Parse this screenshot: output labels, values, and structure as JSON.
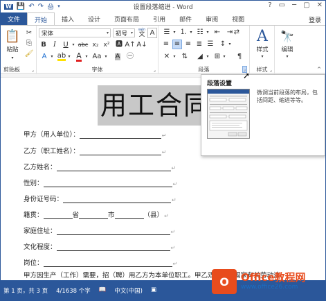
{
  "window": {
    "title": "设置段落缩进 - Word",
    "login": "登录",
    "controls": [
      "?",
      "▭",
      "─",
      "▢",
      "✕"
    ]
  },
  "qat": [
    "Word-icon",
    "save-icon",
    "undo-icon",
    "redo-icon",
    "customize-icon"
  ],
  "tabs": [
    "文件",
    "开始",
    "插入",
    "设计",
    "页面布局",
    "引用",
    "邮件",
    "审阅",
    "视图"
  ],
  "active_tab": "开始",
  "ribbon": {
    "clipboard": {
      "label": "剪贴板",
      "paste": "粘贴"
    },
    "font": {
      "label": "字体",
      "name": "宋体",
      "size": "初号",
      "wen": "wén",
      "A": "A"
    },
    "paragraph": {
      "label": "段落"
    },
    "styles": {
      "label": "样式",
      "button": "样式"
    },
    "editing": {
      "button": "编辑"
    }
  },
  "tooltip": {
    "title": "段落设置",
    "description": "微调当前段落的布局，包括间距、缩进等等。"
  },
  "document": {
    "title": "用工合同",
    "lines": [
      {
        "label": "甲方（用人单位）：",
        "underline": 118
      },
      {
        "label": "乙方（职工姓名）：",
        "underline": 118
      },
      {
        "label": "乙方姓名：",
        "underline": 165
      },
      {
        "label": "性别：",
        "underline": 186
      },
      {
        "label": "身份证号码：",
        "underline": 156
      },
      {
        "label": "籍贯：",
        "underline": 0
      },
      {
        "label": "家庭住址：",
        "underline": 164
      },
      {
        "label": "文化程度：",
        "underline": 164
      },
      {
        "label": "岗位：",
        "underline": 186
      }
    ],
    "jiguan": {
      "seg1": "省",
      "seg2": "市",
      "seg3": "（县）"
    },
    "last_line": "甲方因生产（工作）需要，招（聘）用乙方为本单位职工。甲乙双方根据国家有关劳动法"
  },
  "status": {
    "page": "第 1 页，共 3 页",
    "words": "4/1638 个字",
    "lang": "中文(中国)"
  },
  "watermark": {
    "main": "Office教程网",
    "url": "www.office26.com"
  }
}
